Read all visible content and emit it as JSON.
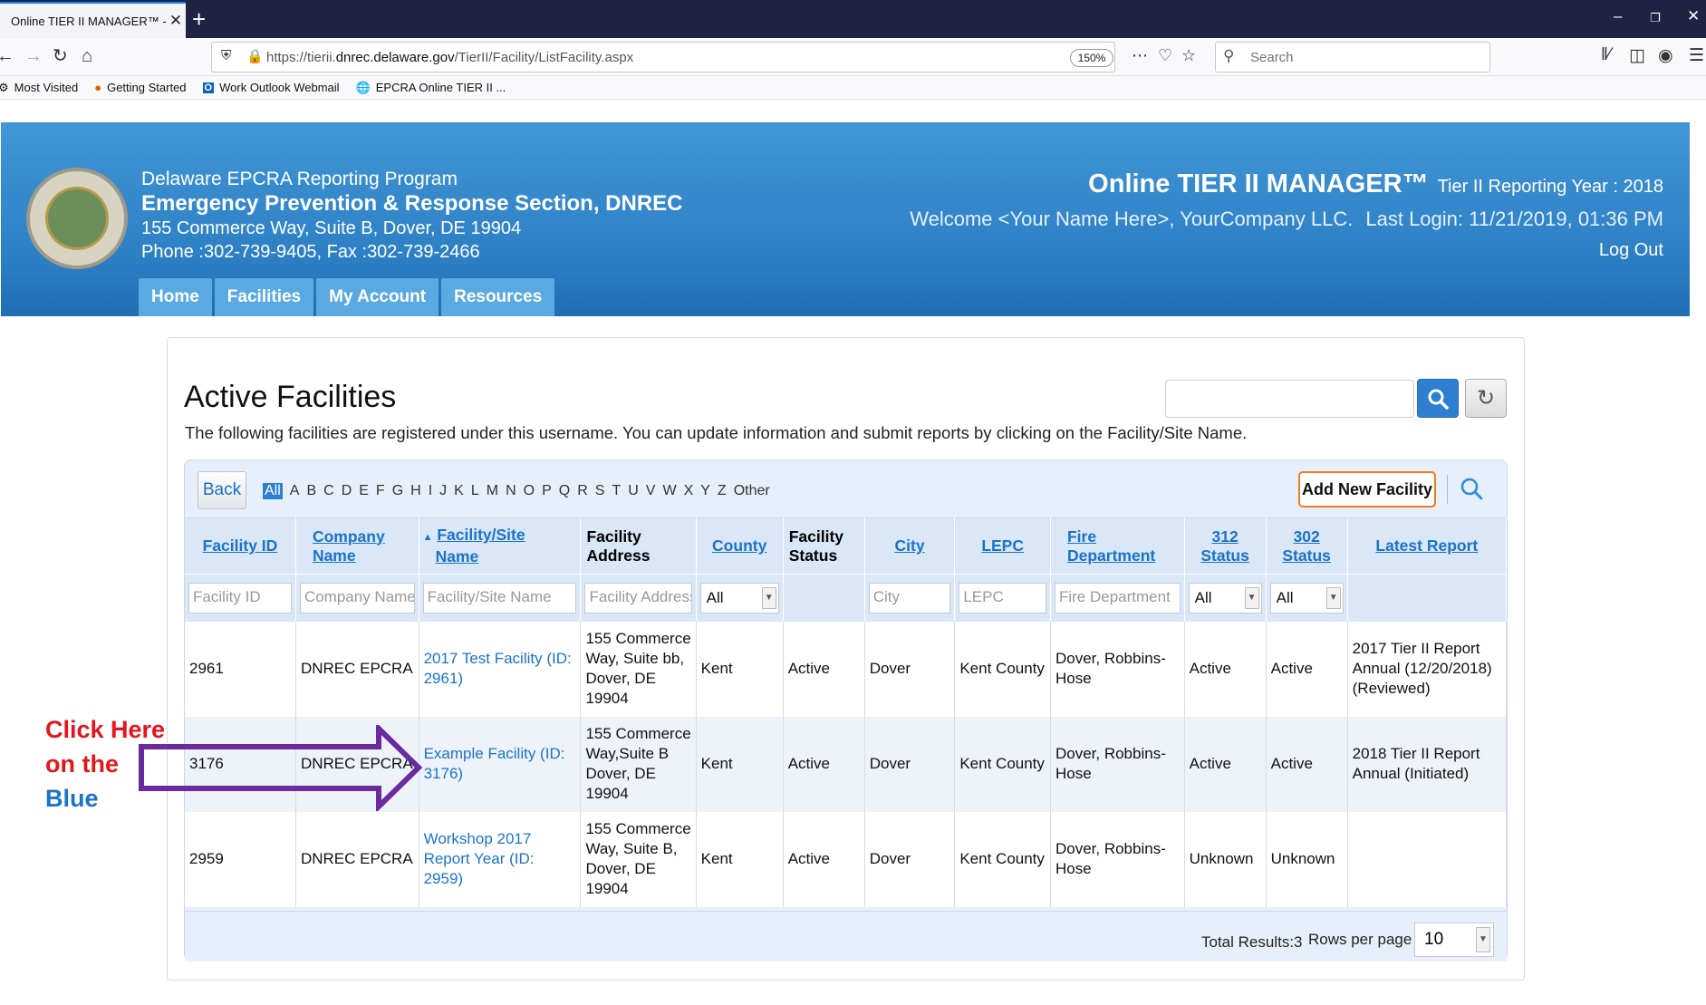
{
  "browser": {
    "tab_title": "Online TIER II MANAGER™ - Fa",
    "tab_close": "✕",
    "new_tab": "+",
    "url_prefix": "https://tierii.",
    "url_domain": "dnrec.delaware.gov",
    "url_path": "/TierII/Facility/ListFacility.aspx",
    "zoom": "150%",
    "search_placeholder": "Search",
    "bookmarks": [
      {
        "label": "Most Visited",
        "icon": "gear-icon"
      },
      {
        "label": "Getting Started",
        "icon": "firefox-icon"
      },
      {
        "label": "Work Outlook Webmail",
        "icon": "outlook-icon"
      },
      {
        "label": "EPCRA Online TIER II ...",
        "icon": "globe-icon"
      }
    ]
  },
  "header": {
    "program": "Delaware EPCRA Reporting Program",
    "section": "Emergency Prevention & Response Section, DNREC",
    "address": "155 Commerce Way, Suite B, Dover, DE 19904",
    "phone": "Phone :302-739-9405, Fax :302-739-2466",
    "app_title": "Online TIER II MANAGER™",
    "reporting_year": "Tier II Reporting Year : 2018",
    "welcome": "Welcome <Your Name Here>, YourCompany LLC.",
    "last_login": "Last Login: 11/21/2019, 01:36 PM",
    "logout": "Log Out",
    "nav": [
      "Home",
      "Facilities",
      "My Account",
      "Resources"
    ]
  },
  "main": {
    "title": "Active Facilities",
    "description": "The following facilities are registered under this username. You can update information and submit reports by clicking on the Facility/Site Name.",
    "back_label": "Back",
    "alphabet": [
      "All",
      "A",
      "B",
      "C",
      "D",
      "E",
      "F",
      "G",
      "H",
      "I",
      "J",
      "K",
      "L",
      "M",
      "N",
      "O",
      "P",
      "Q",
      "R",
      "S",
      "T",
      "U",
      "V",
      "W",
      "X",
      "Y",
      "Z",
      "Other"
    ],
    "add_label": "Add New Facility",
    "columns": {
      "facility_id": "Facility ID",
      "company": [
        "Company",
        "Name"
      ],
      "site": [
        "Facility/Site",
        "Name"
      ],
      "address": [
        "Facility",
        "Address"
      ],
      "county": "County",
      "status": [
        "Facility",
        "Status"
      ],
      "city": "City",
      "lepc": "LEPC",
      "fire": [
        "Fire",
        "Department"
      ],
      "s312": [
        "312",
        "Status"
      ],
      "s302": [
        "302",
        "Status"
      ],
      "latest": "Latest Report"
    },
    "filters": {
      "facility_id": "Facility ID",
      "company": "Company Name",
      "site": "Facility/Site Name",
      "address": "Facility Address",
      "county": "All",
      "city": "City",
      "lepc": "LEPC",
      "fire": "Fire Department",
      "s312": "All",
      "s302": "All"
    },
    "rows": [
      {
        "id": "2961",
        "company": "DNREC EPCRA",
        "site": "2017 Test Facility (ID: 2961)",
        "address": "155 Commerce Way, Suite bb, Dover, DE 19904",
        "county": "Kent",
        "status": "Active",
        "city": "Dover",
        "lepc": "Kent County",
        "fire": "Dover, Robbins-Hose",
        "s312": "Active",
        "s302": "Active",
        "latest": "2017 Tier II Report Annual (12/20/2018) (Reviewed)"
      },
      {
        "id": "3176",
        "company": "DNREC EPCRA",
        "site": "Example Facility (ID: 3176)",
        "address": "155 Commerce Way,Suite B Dover, DE 19904",
        "county": "Kent",
        "status": "Active",
        "city": "Dover",
        "lepc": "Kent County",
        "fire": "Dover, Robbins-Hose",
        "s312": "Active",
        "s302": "Active",
        "latest": "2018 Tier II Report Annual (Initiated)"
      },
      {
        "id": "2959",
        "company": "DNREC EPCRA",
        "site": "Workshop 2017 Report Year (ID: 2959)",
        "address": "155 Commerce Way, Suite B, Dover, DE 19904",
        "county": "Kent",
        "status": "Active",
        "city": "Dover",
        "lepc": "Kent County",
        "fire": "Dover, Robbins-Hose",
        "s312": "Unknown",
        "s302": "Unknown",
        "latest": ""
      }
    ],
    "total_results": "Total Results:3",
    "rows_per_page_label": "Rows per page",
    "rows_per_page": "10"
  },
  "annotation": {
    "line1": "Click Here",
    "line2": "on the",
    "line3": "Blue",
    "arrow_color": "#6a2aa0"
  },
  "colors": {
    "header_blue": "#2d7fc4",
    "link_blue": "#1b73c8",
    "add_border": "#f07a1e",
    "annotation_red": "#e4161d"
  }
}
